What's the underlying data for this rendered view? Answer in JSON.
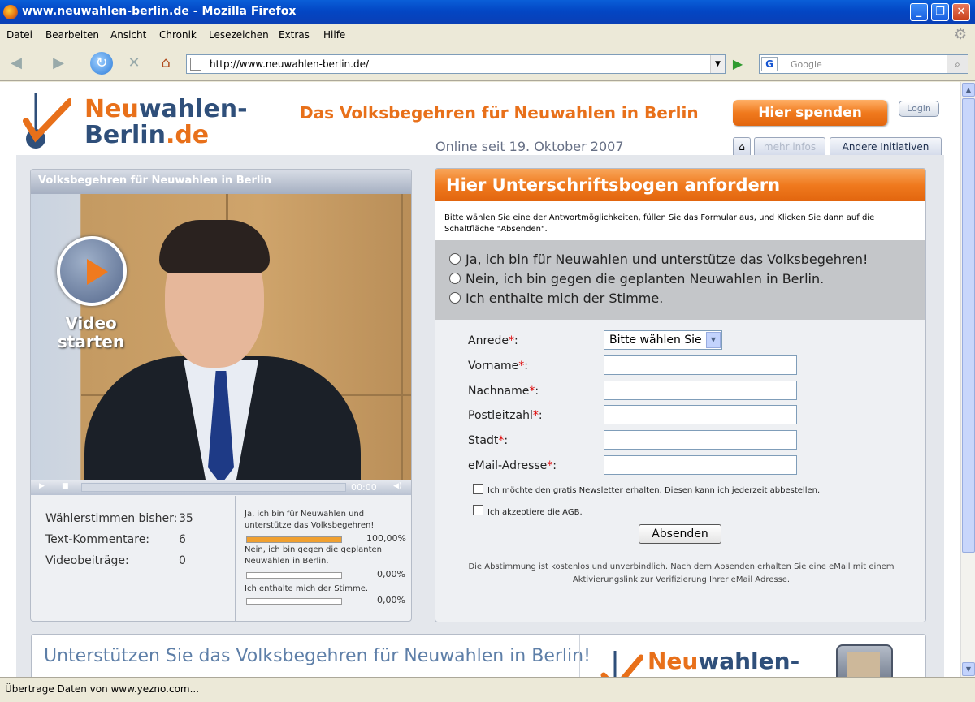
{
  "window": {
    "title": "www.neuwahlen-berlin.de - Mozilla Firefox",
    "minimize": "_",
    "maximize": "❐",
    "close": "✕"
  },
  "menu": [
    "Datei",
    "Bearbeiten",
    "Ansicht",
    "Chronik",
    "Lesezeichen",
    "Extras",
    "Hilfe"
  ],
  "toolbar": {
    "url": "http://www.neuwahlen-berlin.de/",
    "search_placeholder": "Google",
    "search_engine_icon": "G"
  },
  "status": {
    "text": "Übertrage Daten von www.yezno.com..."
  },
  "page": {
    "logo_line1_orange": "Neu",
    "logo_line1_blue": "wahlen-",
    "logo_line2_blue": "Berlin",
    "logo_line2_orange": ".de",
    "headline": "Das Volksbegehren für Neuwahlen in Berlin",
    "since": "Online seit 19. Oktober 2007",
    "donate_label": "Hier spenden",
    "login_label": "Login",
    "tabs": {
      "home_icon": "⌂",
      "info": "mehr infos",
      "andere": "Andere Initiativen"
    },
    "video": {
      "header": "Volksbegehren für Neuwahlen in Berlin",
      "play_line1": "Video",
      "play_line2": "starten",
      "time": "00:00"
    },
    "stats": [
      {
        "label": "Wählerstimmen bisher:",
        "value": "35"
      },
      {
        "label": "Text-Kommentare:",
        "value": "6"
      },
      {
        "label": "Videobeiträge:",
        "value": "0"
      }
    ],
    "results": [
      {
        "text": "Ja, ich bin für Neuwahlen und unterstütze das Volksbegehren!",
        "percent_label": "100,00%",
        "fraction": 1.0
      },
      {
        "text": "Nein, ich bin gegen die geplanten Neuwahlen in Berlin.",
        "percent_label": "0,00%",
        "fraction": 0.0
      },
      {
        "text": "Ich enthalte mich der Stimme.",
        "percent_label": "0,00%",
        "fraction": 0.0
      }
    ],
    "form": {
      "header": "Hier Unterschriftsbogen anfordern",
      "instructions": "Bitte wählen Sie eine der Antwortmöglichkeiten, füllen Sie das Formular aus, und Klicken Sie dann auf die Schaltfläche \"Absenden\".",
      "choices": [
        "Ja, ich bin für Neuwahlen und unterstütze das Volksbegehren!",
        "Nein, ich bin gegen die geplanten Neuwahlen in Berlin.",
        "Ich enthalte mich der Stimme."
      ],
      "anrede_label": "Anrede",
      "anrede_value": "Bitte wählen Sie",
      "vorname_label": "Vorname",
      "nachname_label": "Nachname",
      "plz_label": "Postleitzahl",
      "stadt_label": "Stadt",
      "email_label": "eMail-Adresse",
      "required_mark": "*",
      "label_suffix": ":",
      "newsletter_label": "Ich möchte den gratis Newsletter erhalten. Diesen kann ich jederzeit abbestellen.",
      "agb_label": "Ich akzeptiere die AGB.",
      "submit_label": "Absenden",
      "note": "Die Abstimmung ist kostenlos und unverbindlich. Nach dem Absenden erhalten Sie eine eMail mit einem Aktivierungslink zur Verifizierung Ihrer eMail Adresse."
    },
    "banner": {
      "text": "Unterstützen Sie das Volksbegehren für Neuwahlen in Berlin!",
      "logo_orange": "Neu",
      "logo_blue": "wahlen-"
    }
  },
  "colors": {
    "brand_orange": "#e8701a",
    "brand_blue": "#2f4f7a",
    "titlebar_blue": "#0346c4"
  }
}
